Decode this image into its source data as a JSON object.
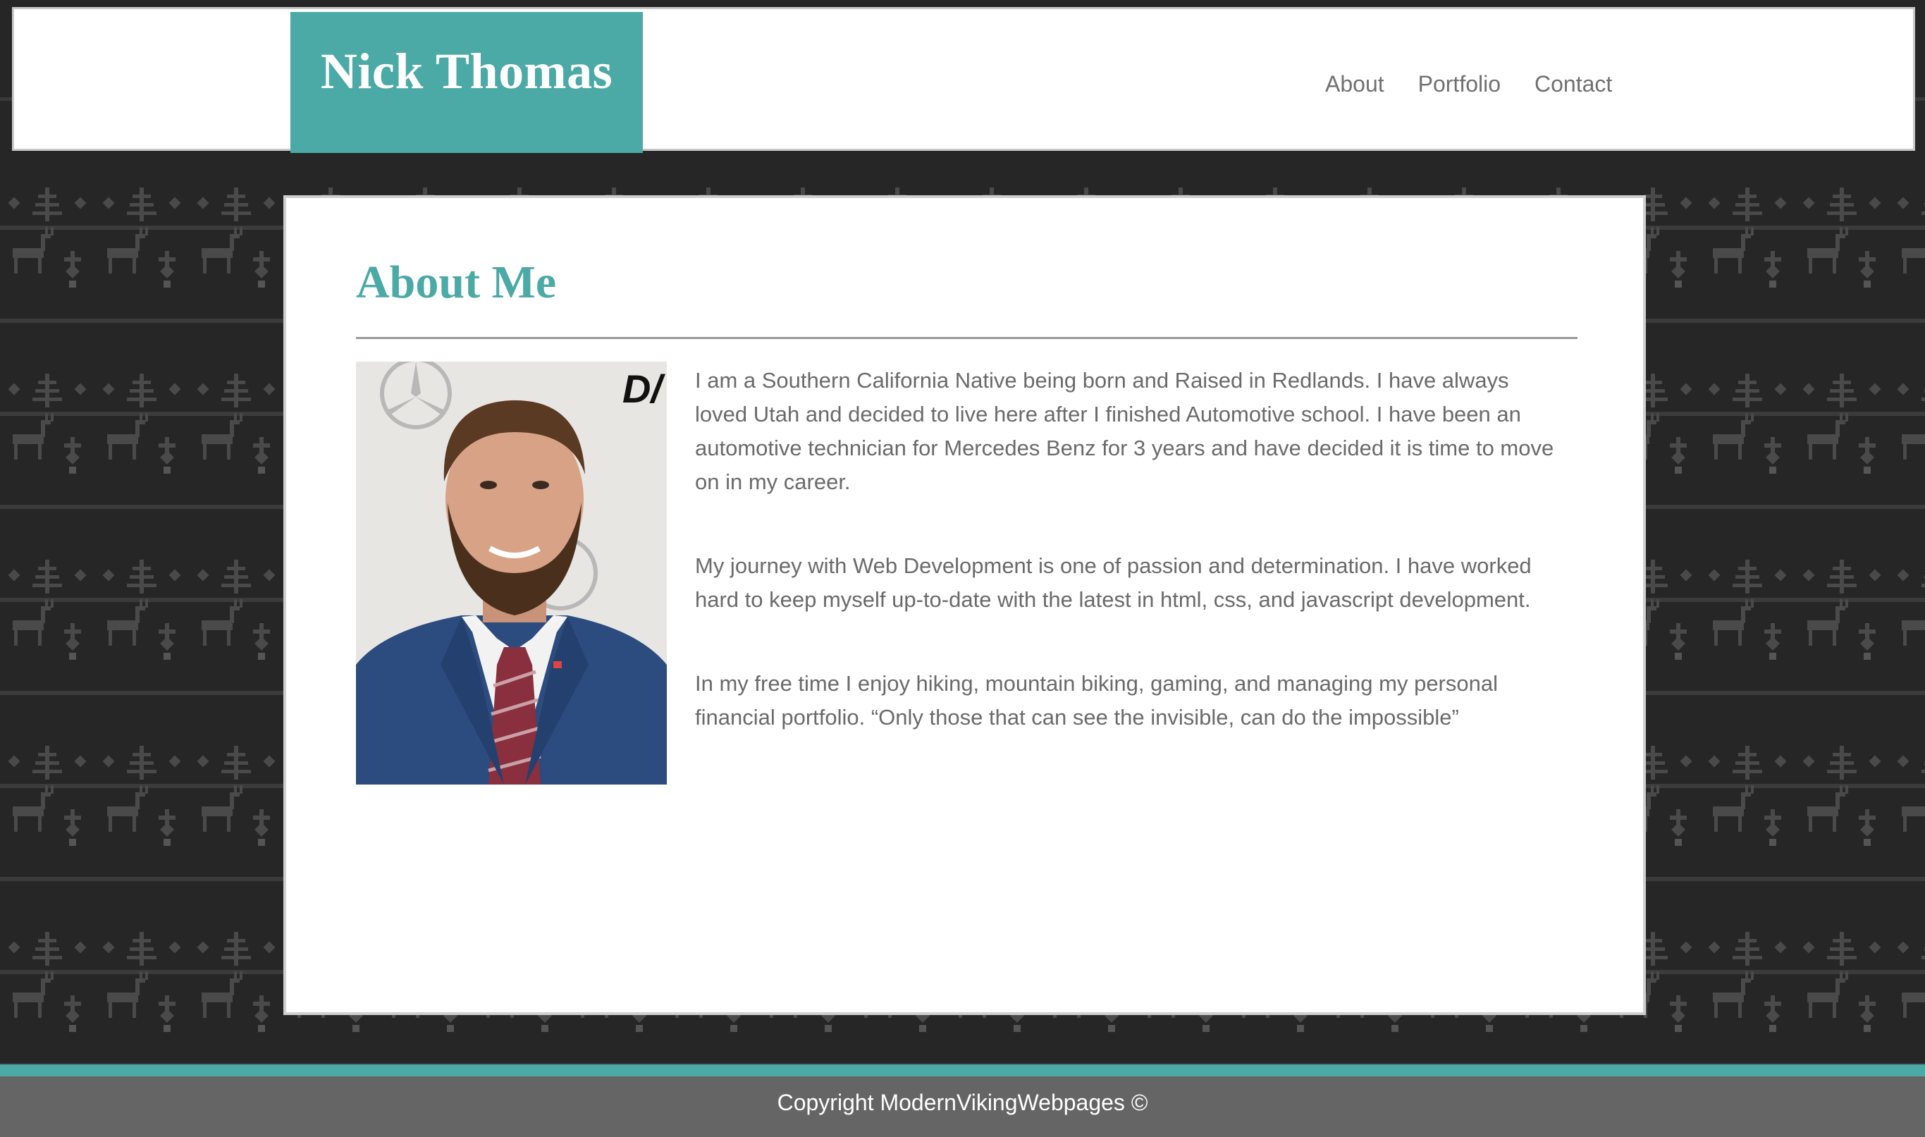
{
  "header": {
    "brand": "Nick Thomas",
    "nav": [
      "About",
      "Portfolio",
      "Contact"
    ]
  },
  "about": {
    "title": "About Me",
    "photo_alt": "Portrait photo",
    "paragraphs": [
      "I am a Southern California Native being born and Raised in Redlands. I have always loved Utah and decided to live here after I finished Automotive school. I have been an automotive technician for Mercedes Benz for 3 years and have decided it is time to move on in my career.",
      "My journey with Web Development is one of passion and determination. I have worked hard to keep myself up-to-date with the latest in html, css, and javascript development.",
      "In my free time I enjoy hiking, mountain biking, gaming, and managing my personal financial portfolio. “Only those that can see the invisible, can do the impossible”"
    ]
  },
  "footer": {
    "copyright": "Copyright ModernVikingWebpages ©"
  },
  "colors": {
    "accent": "#4ba9a6",
    "background": "#262626",
    "footer": "#656565"
  }
}
